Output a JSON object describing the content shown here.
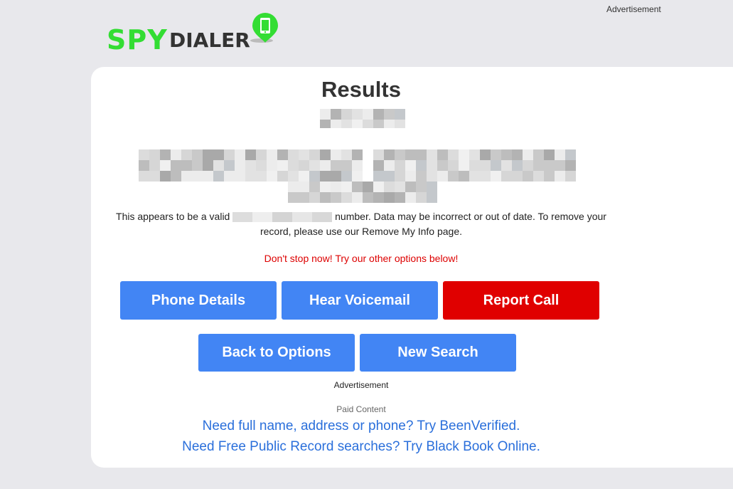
{
  "top_ad": "Advertisement",
  "logo": {
    "spy": "SPY",
    "dialer": "DIALER",
    "tm": "™"
  },
  "results": {
    "title": "Results",
    "message_pre": "This appears to be a valid",
    "message_post": "number. Data may be incorrect or out of date. To remove your record, please use our Remove My Info page.",
    "dont_stop": "Don't stop now! Try our other options below!"
  },
  "buttons": {
    "phone_details": "Phone Details",
    "hear_voicemail": "Hear Voicemail",
    "report_call": "Report Call",
    "back_to_options": "Back to Options",
    "new_search": "New Search"
  },
  "ad_mid": "Advertisement",
  "paid_content": "Paid Content",
  "promos": {
    "been_verified": "Need full name, address or phone? Try BeenVerified.",
    "black_book": "Need Free Public Record searches? Try Black Book Online."
  },
  "colors": {
    "brand_green": "#33dd33",
    "button_blue": "#4285f4",
    "button_red": "#e00000",
    "link_blue": "#2a6fdb",
    "warning_red": "#dd0000"
  }
}
